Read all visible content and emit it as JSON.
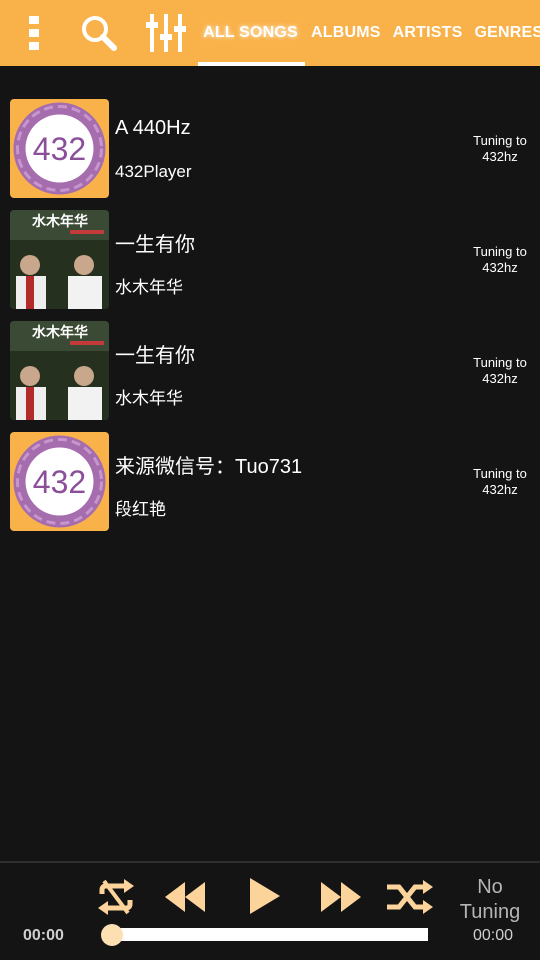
{
  "colors": {
    "toolbar": "#f9b24a",
    "background": "#141414",
    "accent": "#fcd39a",
    "logo_purple": "#8b4f9a"
  },
  "toolbar": {
    "icons": [
      "menu-icon",
      "search-icon",
      "equalizer-icon"
    ],
    "tabs": [
      {
        "label": "ALL SONGS",
        "active": true
      },
      {
        "label": "ALBUMS",
        "active": false
      },
      {
        "label": "ARTISTS",
        "active": false
      },
      {
        "label": "GENRES",
        "active": false
      }
    ]
  },
  "songs": [
    {
      "title": "A 440Hz",
      "artist": "432Player",
      "tuning": "Tuning to 432hz",
      "art": "432-logo",
      "art_text": "432"
    },
    {
      "title": "一生有你",
      "artist": "水木年华",
      "tuning": "Tuning to 432hz",
      "art": "album-photo",
      "art_text": "水木年华"
    },
    {
      "title": "一生有你",
      "artist": "水木年华",
      "tuning": "Tuning to 432hz",
      "art": "album-photo",
      "art_text": "水木年华"
    },
    {
      "title": "来源微信号：Tuo731",
      "artist": "段红艳",
      "tuning": "Tuning to 432hz",
      "art": "432-logo",
      "art_text": "432"
    }
  ],
  "player": {
    "elapsed": "00:00",
    "remaining": "00:00",
    "tuning_status": "No Tuning",
    "progress": 0,
    "controls": [
      "repeat-off-icon",
      "rewind-icon",
      "play-icon",
      "fast-forward-icon",
      "shuffle-icon"
    ]
  }
}
